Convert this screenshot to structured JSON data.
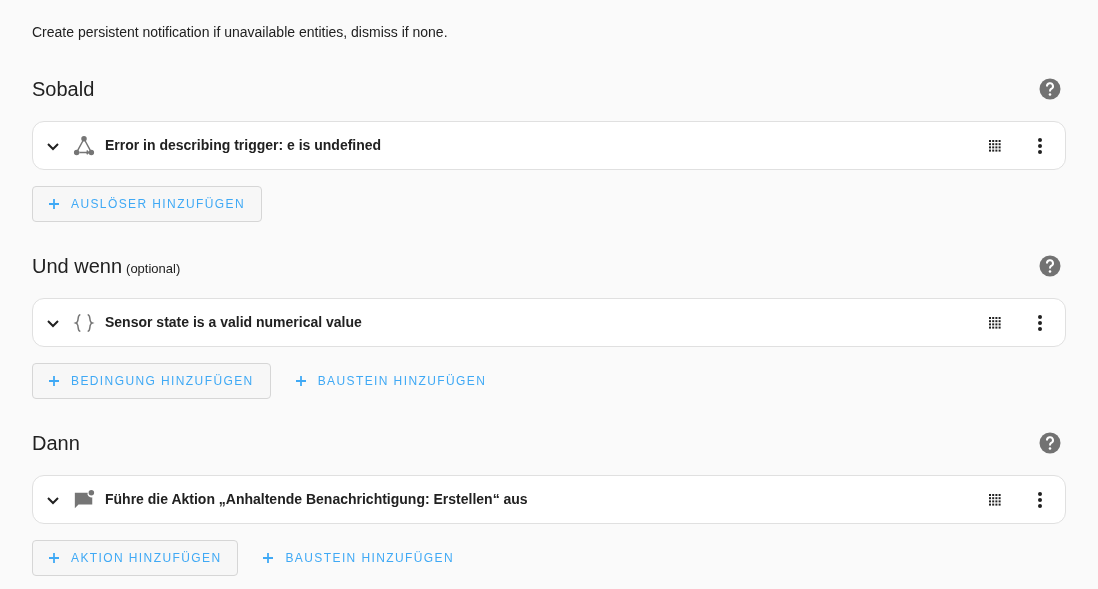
{
  "description": "Create persistent notification if unavailable entities, dismiss if none.",
  "sections": [
    {
      "title": "Sobald",
      "rows": [
        {
          "kind": "trigger",
          "text": "Error in describing trigger: e is undefined"
        }
      ],
      "buttons": [
        {
          "label": "AUSLÖSER HINZUFÜGEN",
          "kind": "outlined"
        }
      ]
    },
    {
      "title": "Und wenn",
      "note": "(optional)",
      "rows": [
        {
          "kind": "template",
          "text": "Sensor state is a valid numerical value"
        }
      ],
      "buttons": [
        {
          "label": "BEDINGUNG HINZUFÜGEN",
          "kind": "outlined"
        },
        {
          "label": "BAUSTEIN HINZUFÜGEN",
          "kind": "text"
        }
      ]
    },
    {
      "title": "Dann",
      "rows": [
        {
          "kind": "notification",
          "text": "Führe die Aktion „Anhaltende Benachrichtigung: Erstellen“ aus"
        }
      ],
      "buttons": [
        {
          "label": "AKTION HINZUFÜGEN",
          "kind": "outlined"
        },
        {
          "label": "BAUSTEIN HINZUFÜGEN",
          "kind": "text"
        }
      ]
    }
  ]
}
